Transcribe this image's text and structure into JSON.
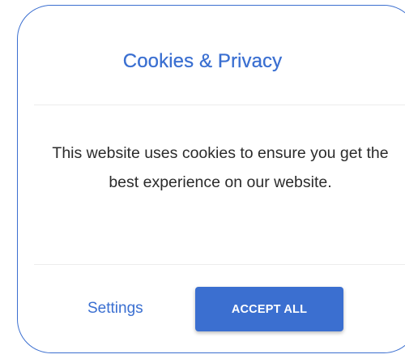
{
  "dialog": {
    "title": "Cookies & Privacy",
    "message": "This website uses cookies to ensure you get the best experience on our website."
  },
  "actions": {
    "settings_label": "Settings",
    "accept_label": "ACCEPT ALL"
  },
  "colors": {
    "accent": "#3b6fd0",
    "text": "#2b2b2b",
    "divider": "#ececec",
    "background": "#ffffff"
  }
}
